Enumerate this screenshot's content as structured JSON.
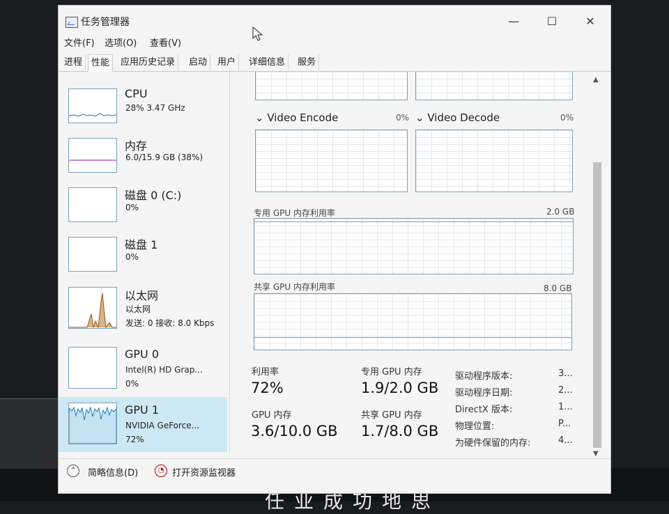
{
  "window": {
    "title": "任务管理器",
    "minimize": "—",
    "maximize": "☐",
    "close": "✕"
  },
  "menu": [
    "文件(F)",
    "选项(O)",
    "查看(V)"
  ],
  "tabs": [
    "进程",
    "性能",
    "应用历史记录",
    "启动",
    "用户",
    "详细信息",
    "服务"
  ],
  "active_tab": "性能",
  "sidebar": {
    "items": [
      {
        "title": "CPU",
        "sub1": "28% 3.47 GHz",
        "sub2": "",
        "sub3": ""
      },
      {
        "title": "内存",
        "sub1": "6.0/15.9 GB (38%)",
        "sub2": "",
        "sub3": ""
      },
      {
        "title": "磁盘 0 (C:)",
        "sub1": "0%",
        "sub2": "",
        "sub3": ""
      },
      {
        "title": "磁盘 1",
        "sub1": "0%",
        "sub2": "",
        "sub3": ""
      },
      {
        "title": "以太网",
        "sub1": "以太网",
        "sub2": "发送: 0 接收: 8.0 Kbps",
        "sub3": ""
      },
      {
        "title": "GPU 0",
        "sub1": "Intel(R) HD Grap...",
        "sub2": "0%",
        "sub3": ""
      },
      {
        "title": "GPU 1",
        "sub1": "NVIDIA GeForce...",
        "sub2": "72%",
        "sub3": ""
      }
    ],
    "selected_index": 6
  },
  "gpu_panel": {
    "video_encode": {
      "label": "Video Encode",
      "value": "0%"
    },
    "video_decode": {
      "label": "Video Decode",
      "value": "0%"
    },
    "dedicated_graph": {
      "label": "专用 GPU 内存利用率",
      "max": "2.0 GB"
    },
    "shared_graph": {
      "label": "共享 GPU 内存利用率",
      "max": "8.0 GB"
    },
    "stats": {
      "utilization_label": "利用率",
      "utilization_value": "72%",
      "dedicated_label": "专用 GPU 内存",
      "dedicated_value": "1.9/2.0 GB",
      "gpu_memory_label": "GPU 内存",
      "gpu_memory_value": "3.6/10.0 GB",
      "shared_label": "共享 GPU 内存",
      "shared_value": "1.7/8.0 GB"
    },
    "properties": [
      {
        "label": "驱动程序版本:",
        "value": "3..."
      },
      {
        "label": "驱动程序日期:",
        "value": "2..."
      },
      {
        "label": "DirectX 版本:",
        "value": "1..."
      },
      {
        "label": "物理位置:",
        "value": "P..."
      },
      {
        "label": "为硬件保留的内存:",
        "value": "4..."
      }
    ]
  },
  "footer": {
    "summary": "简略信息(D)",
    "monitor": "打开资源监视器"
  },
  "colors": {
    "selected_bg": "#cce8f2",
    "graph_border": "#7d9eb2",
    "cpu_line": "#117dbb",
    "net_line": "#a74f01",
    "gpu_line": "#117dbb"
  },
  "background": {
    "text": "任业成功地思"
  }
}
